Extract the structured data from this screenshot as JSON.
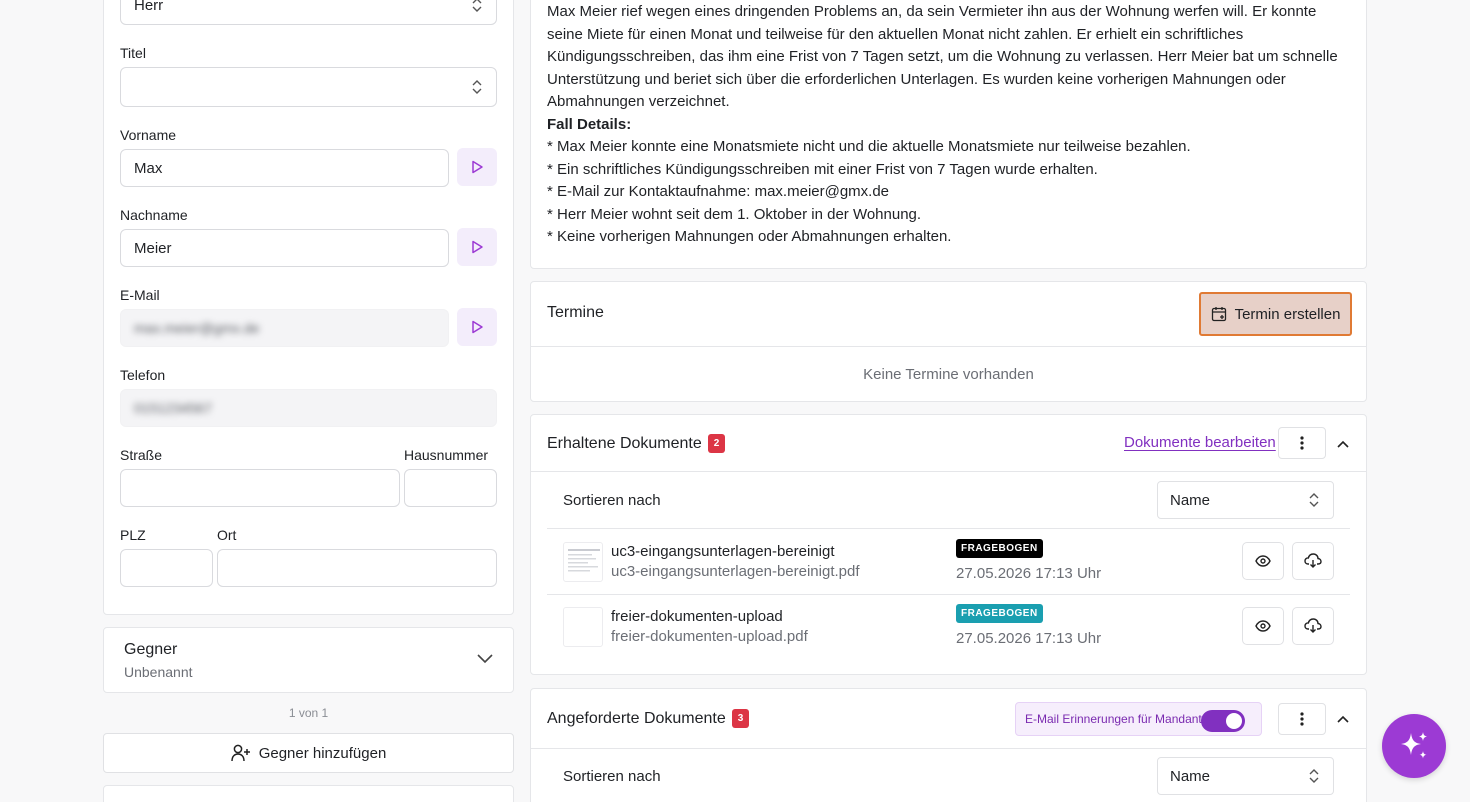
{
  "left_form": {
    "anrede_value": "Herr",
    "titel_label": "Titel",
    "titel_value": "",
    "vorname_label": "Vorname",
    "vorname_value": "Max",
    "nachname_label": "Nachname",
    "nachname_value": "Meier",
    "email_label": "E-Mail",
    "email_value": "max.meier@gmx.de",
    "telefon_label": "Telefon",
    "telefon_value": "0151234567",
    "strasse_label": "Straße",
    "hausnummer_label": "Hausnummer",
    "plz_label": "PLZ",
    "ort_label": "Ort"
  },
  "gegner": {
    "title": "Gegner",
    "subtitle": "Unbenannt",
    "pager": "1 von 1",
    "add_label": "Gegner hinzufügen"
  },
  "summary": {
    "paragraph": "Max Meier rief wegen eines dringenden Problems an, da sein Vermieter ihn aus der Wohnung werfen will. Er konnte seine Miete für einen Monat und teilweise für den aktuellen Monat nicht zahlen. Er erhielt ein schriftliches Kündigungsschreiben, das ihm eine Frist von 7 Tagen setzt, um die Wohnung zu verlassen. Herr Meier bat um schnelle Unterstützung und beriet sich über die erforderlichen Unterlagen. Es wurden keine vorherigen Mahnungen oder Abmahnungen verzeichnet.",
    "details_heading": "Fall Details:",
    "details": [
      "* Max Meier konnte eine Monatsmiete nicht und die aktuelle Monatsmiete nur teilweise bezahlen.",
      "* Ein schriftliches Kündigungsschreiben mit einer Frist von 7 Tagen wurde erhalten.",
      "* E-Mail zur Kontaktaufnahme: max.meier@gmx.de",
      "* Herr Meier wohnt seit dem 1. Oktober in der Wohnung.",
      "* Keine vorherigen Mahnungen oder Abmahnungen erhalten."
    ]
  },
  "termine": {
    "title": "Termine",
    "button_label": "Termin erstellen",
    "empty_text": "Keine Termine vorhanden"
  },
  "erhaltene": {
    "title": "Erhaltene Dokumente",
    "count": "2",
    "edit_link": "Dokumente bearbeiten",
    "sort_label": "Sortieren nach",
    "sort_value": "Name",
    "documents": [
      {
        "name": "uc3-eingangsunterlagen-bereinigt",
        "file": "uc3-eingangsunterlagen-bereinigt.pdf",
        "tag": "FRAGEBOGEN",
        "tag_color": "#000000",
        "date": "27.05.2026 17:13 Uhr"
      },
      {
        "name": "freier-dokumenten-upload",
        "file": "freier-dokumenten-upload.pdf",
        "tag": "FRAGEBOGEN",
        "tag_color": "#1a9fb0",
        "date": "27.05.2026 17:13 Uhr"
      }
    ]
  },
  "angeforderte": {
    "title": "Angeforderte Dokumente",
    "count": "3",
    "reminder_label": "E-Mail Erinnerungen für Mandant",
    "reminder_on": true,
    "sort_label": "Sortieren nach",
    "sort_value": "Name"
  },
  "colors": {
    "accent": "#9c3ad4",
    "danger": "#dc3545",
    "highlight_border": "#e07a34"
  }
}
